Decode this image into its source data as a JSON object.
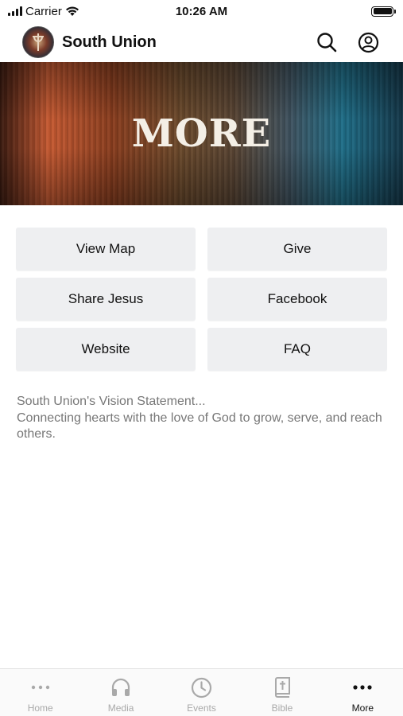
{
  "status_bar": {
    "carrier": "Carrier",
    "time": "10:26 AM"
  },
  "header": {
    "title": "South Union",
    "logo_icon": "church-logo",
    "search_icon": "search-icon",
    "account_icon": "account-icon"
  },
  "hero": {
    "title": "MORE"
  },
  "buttons": [
    {
      "label": "View Map"
    },
    {
      "label": "Give"
    },
    {
      "label": "Share Jesus"
    },
    {
      "label": "Facebook"
    },
    {
      "label": "Website"
    },
    {
      "label": "FAQ"
    }
  ],
  "vision": {
    "heading": "South Union's Vision Statement...",
    "body": "Connecting hearts with the love of God to grow, serve, and reach others."
  },
  "tabs": [
    {
      "label": "Home",
      "icon": "dots-icon",
      "active": false
    },
    {
      "label": "Media",
      "icon": "headphones-icon",
      "active": false
    },
    {
      "label": "Events",
      "icon": "clock-icon",
      "active": false
    },
    {
      "label": "Bible",
      "icon": "bible-icon",
      "active": false
    },
    {
      "label": "More",
      "icon": "more-icon",
      "active": true
    }
  ],
  "colors": {
    "tab_inactive": "#a9a9a9",
    "tab_active": "#111111",
    "button_bg": "#eeeff1",
    "vision_text": "#777777"
  }
}
